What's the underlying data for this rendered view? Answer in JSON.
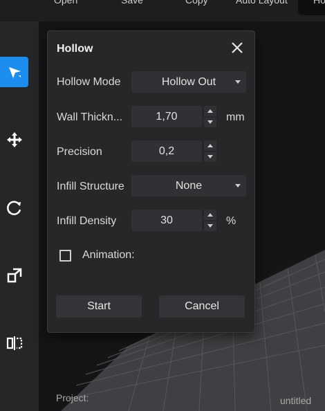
{
  "toolbar": {
    "open_label": "Open",
    "save_label": "Save",
    "copy_label": "Copy",
    "auto_layout_label": "Auto Layout",
    "active_tab_label": "Ho"
  },
  "left_tools": [
    {
      "icon": "select-arrow-icon",
      "active": true
    },
    {
      "icon": "move-icon",
      "active": false
    },
    {
      "icon": "rotate-icon",
      "active": false
    },
    {
      "icon": "scale-icon",
      "active": false
    },
    {
      "icon": "mirror-icon",
      "active": false
    }
  ],
  "dialog": {
    "title": "Hollow",
    "hollow_mode": {
      "label": "Hollow Mode",
      "value": "Hollow Out"
    },
    "wall_thickness": {
      "label": "Wall Thickn...",
      "value": "1,70",
      "unit": "mm"
    },
    "precision": {
      "label": "Precision",
      "value": "0,2"
    },
    "infill_structure": {
      "label": "Infill Structure",
      "value": "None"
    },
    "infill_density": {
      "label": "Infill Density",
      "value": "30",
      "unit": "%"
    },
    "animation": {
      "label": "Animation:",
      "checked": false
    },
    "start_label": "Start",
    "cancel_label": "Cancel"
  },
  "footer": {
    "project_label": "Project:",
    "project_name": "untitled"
  },
  "colors": {
    "accent": "#1b8ef0",
    "dialog_bg": "#262729",
    "field_bg": "#303134"
  }
}
